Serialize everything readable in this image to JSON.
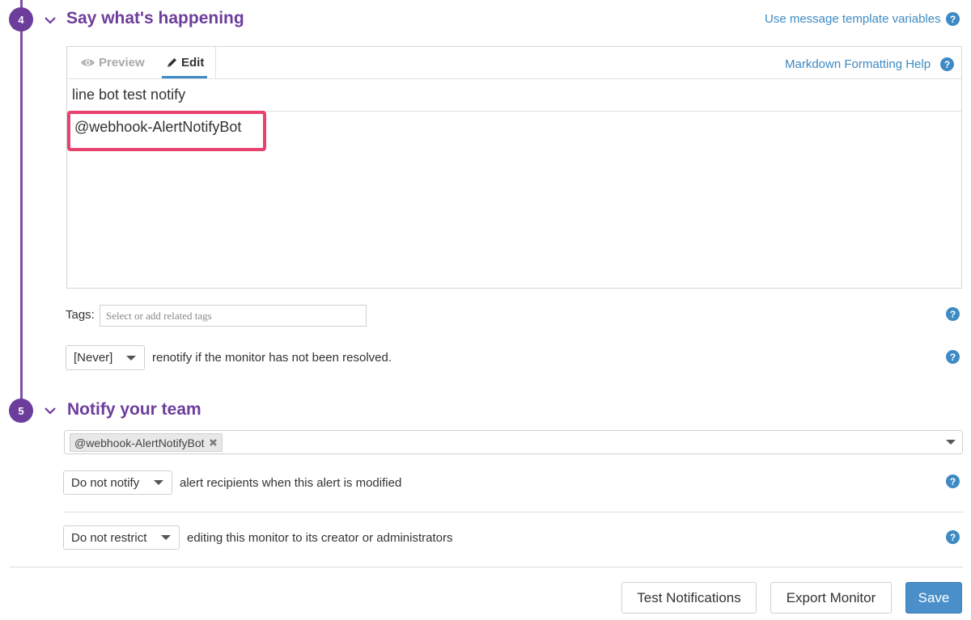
{
  "step4": {
    "number": "4",
    "title": "Say what's happening",
    "template_link": "Use message template variables",
    "help": "?"
  },
  "editor": {
    "tab_preview": "Preview",
    "tab_edit": "Edit",
    "markdown_help": "Markdown Formatting Help",
    "title_value": "line bot test notify",
    "body_value": "@webhook-AlertNotifyBot"
  },
  "tags": {
    "label": "Tags:",
    "placeholder": "Select or add related tags"
  },
  "renotify": {
    "selected": "[Never]",
    "text": "renotify if the monitor has not been resolved."
  },
  "step5": {
    "number": "5",
    "title": "Notify your team"
  },
  "notify": {
    "recipient_chip": "@webhook-AlertNotifyBot",
    "modified_selected": "Do not notify",
    "modified_text": "alert recipients when this alert is modified",
    "restrict_selected": "Do not restrict",
    "restrict_text": "editing this monitor to its creator or administrators"
  },
  "actions": {
    "test_label": "Test Notifications",
    "export_label": "Export Monitor",
    "save_label": "Save"
  },
  "colors": {
    "accent_purple": "#6d3d9c",
    "link_blue": "#3d8ac4",
    "highlight_pink": "#e8416e",
    "primary_button": "#4a8fc9"
  }
}
